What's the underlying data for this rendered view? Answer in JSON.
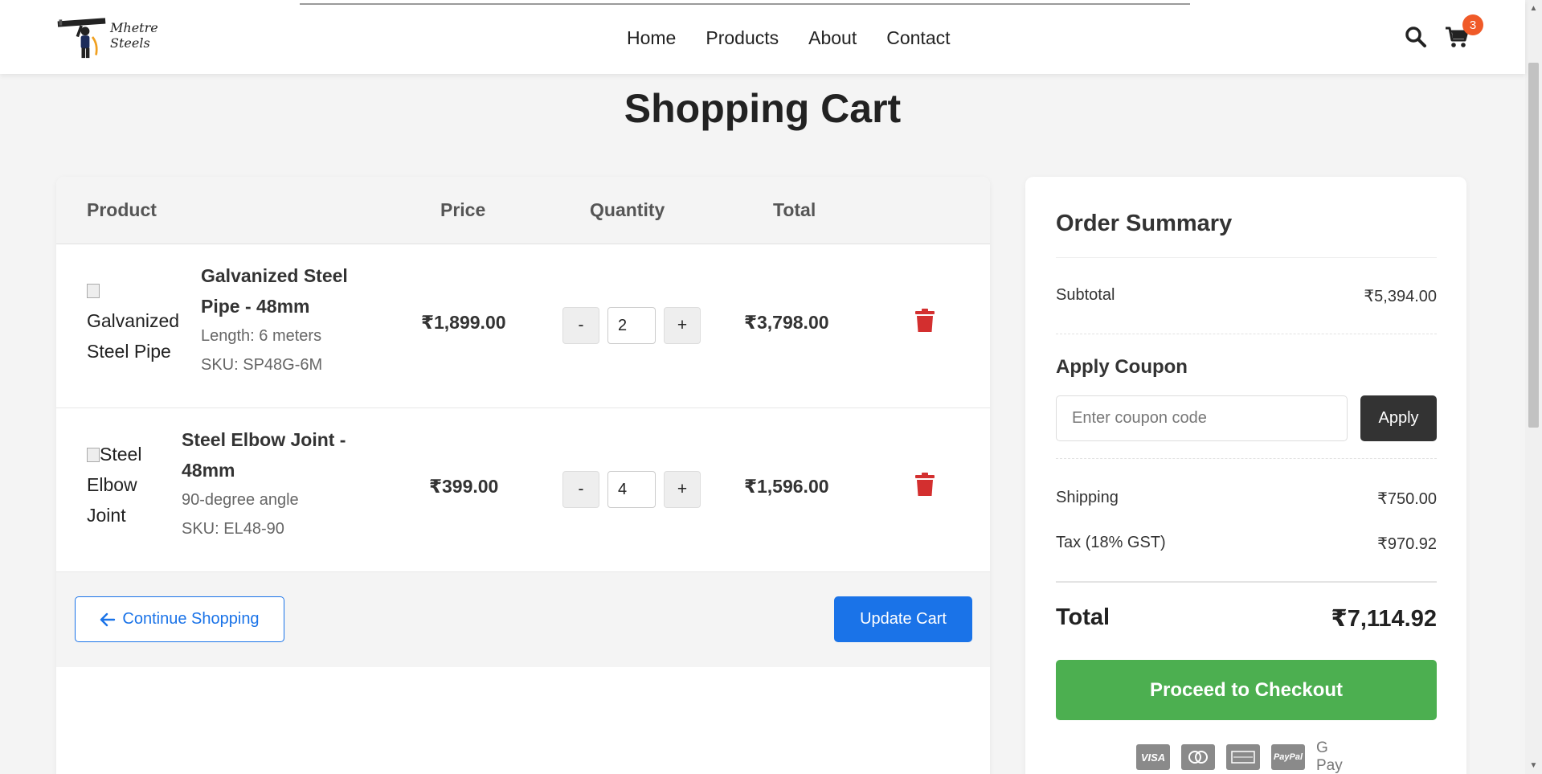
{
  "brand": {
    "name": "Mhetre Steels",
    "logo_icon": "worker-carrying-beam-logo"
  },
  "nav": {
    "home": "Home",
    "products": "Products",
    "about": "About",
    "contact": "Contact"
  },
  "header": {
    "search_icon": "search-icon",
    "cart_icon": "cart-icon",
    "cart_count": "3"
  },
  "page": {
    "title": "Shopping Cart"
  },
  "cart": {
    "columns": {
      "product": "Product",
      "price": "Price",
      "quantity": "Quantity",
      "total": "Total"
    },
    "items": [
      {
        "image_alt_line1": "Galvanized",
        "image_alt_line2": "Steel Pipe",
        "name_line1": "Galvanized Steel",
        "name_line2": "Pipe - 48mm",
        "detail": "Length: 6 meters",
        "sku": "SKU: SP48G-6M",
        "price": "₹1,899.00",
        "quantity": "2",
        "total": "₹3,798.00"
      },
      {
        "image_alt_line1": "Steel",
        "image_alt_line2": "Elbow",
        "image_alt_line3": "Joint",
        "name_line1": "Steel Elbow Joint -",
        "name_line2": "48mm",
        "detail": "90-degree angle",
        "sku": "SKU: EL48-90",
        "price": "₹399.00",
        "quantity": "4",
        "total": "₹1,596.00"
      }
    ],
    "minus_label": "-",
    "plus_label": "+",
    "continue_label": "Continue Shopping",
    "update_label": "Update Cart"
  },
  "summary": {
    "title": "Order Summary",
    "subtotal_label": "Subtotal",
    "subtotal_value": "₹5,394.00",
    "coupon_title": "Apply Coupon",
    "coupon_placeholder": "Enter coupon code",
    "apply_label": "Apply",
    "shipping_label": "Shipping",
    "shipping_value": "₹750.00",
    "tax_label": "Tax (18% GST)",
    "tax_value": "₹970.92",
    "total_label": "Total",
    "total_value": "₹7,114.92",
    "checkout_label": "Proceed to Checkout",
    "payments": {
      "visa": "VISA",
      "paypal": "PayPal",
      "gpay": "G Pay"
    }
  },
  "colors": {
    "primary": "#1a73e8",
    "checkout": "#4caf50",
    "danger": "#d32f2f",
    "badge": "#f05a28",
    "dark_button": "#333333"
  }
}
